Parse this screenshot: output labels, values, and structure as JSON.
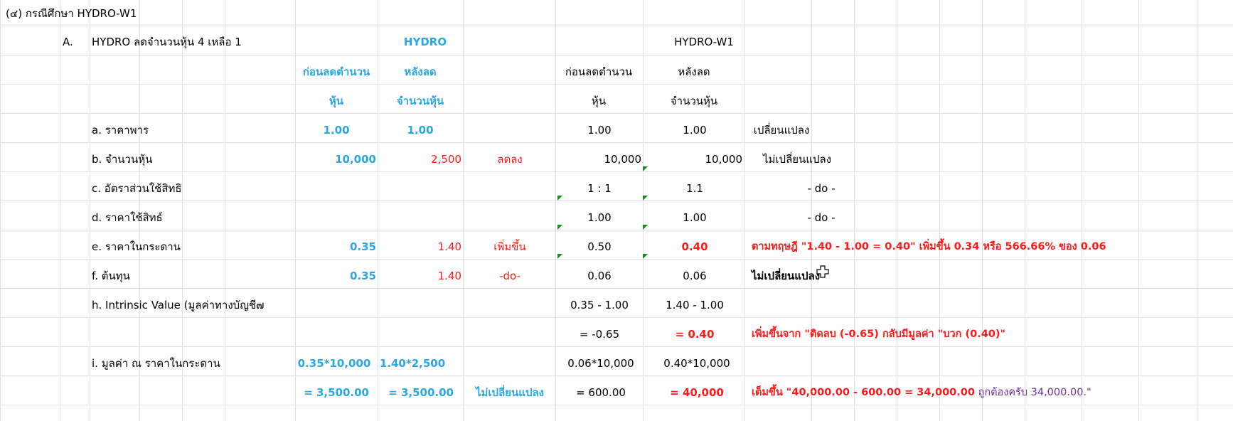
{
  "sheet": {
    "title": "(๔) กรณีศึกษา HYDRO-W1",
    "section_label": "A.",
    "section_title": "HYDRO ลดจำนวนหุ้น 4 เหลือ 1",
    "hydro_header": "HYDRO",
    "hydrow1_header": "HYDRO-W1",
    "col_before_1": "ก่อนลดตำนวน",
    "col_before_2": "หุ้น",
    "col_after_1": "หลังลด",
    "col_after_2": "จำนวนหุ้น",
    "w1_col_before_1": "ก่อนลดตำนวน",
    "w1_col_before_2": "หุ้น",
    "w1_col_after_1": "หลังลด",
    "w1_col_after_2": "จำนวนหุ้น",
    "rows": {
      "a": {
        "label": "a. ราคาพาร",
        "h_before": "1.00",
        "h_after": "1.00",
        "note": "",
        "w_before": "1.00",
        "w_after": "1.00",
        "comment": "เปลี่ยนแปลง"
      },
      "b": {
        "label": "b. จำนวนหุ้น",
        "h_before": "10,000",
        "h_after": "2,500",
        "note": "ลดลง",
        "w_before": "10,000",
        "w_after": "10,000",
        "comment": "ไม่เปลี่ยนแปลง"
      },
      "c": {
        "label": "c. อัตราส่วนใช้สิทธิ",
        "w_before": "1 : 1",
        "w_after": "1.1",
        "comment": "- do -"
      },
      "d": {
        "label": "d. ราคาใช้สิทธ์",
        "w_before": "1.00",
        "w_after": "1.00",
        "comment": "- do -"
      },
      "e": {
        "label": "e. ราคาในกระดาน",
        "h_before": "0.35",
        "h_after": "1.40",
        "note": "เพิ่มขึ้น",
        "w_before": "0.50",
        "w_after": "0.40",
        "comment": "ตามทฤษฎี \"1.40 - 1.00 = 0.40\" เพิ่มขึ้น 0.34 หรือ 566.66% ของ 0.06"
      },
      "f": {
        "label": "f.  ต้นทุน",
        "h_before": "0.35",
        "h_after": "1.40",
        "note": "-do-",
        "w_before": "0.06",
        "w_after": "0.06",
        "comment": "ไม่เปลี่ยนแปลง"
      },
      "h": {
        "label": "h.  Intrinsic Value (มูลค่าทางบัญชี๗",
        "w_before": "0.35 - 1.00",
        "w_after": "1.40 - 1.00"
      },
      "h2": {
        "w_before": "= -0.65",
        "w_after": "= 0.40",
        "comment": "เพิ่มขึ้นจาก \"ติดลบ (-0.65) กลับมีมูลค่า \"บวก (0.40)\""
      },
      "i": {
        "label": "i. มูลค่า ณ ราคาในกระดาน",
        "h_before": "0.35*10,000",
        "h_after": "1.40*2,500",
        "w_before": "0.06*10,000",
        "w_after": "0.40*10,000"
      },
      "i2": {
        "h_before": "= 3,500.00",
        "h_after": "= 3,500.00",
        "note": "ไม่เปลี่ยนแปลง",
        "w_before": "= 600.00",
        "w_after": "= 40,000",
        "comment_red": "เต็มขึ้น \"40,000.00 - 600.00 = 34,000.00",
        "comment_purple": "ถูกต้องครับ 34,000.00.\""
      }
    }
  },
  "colors": {
    "blue": "#2aa7e4",
    "red": "#ff1a1a",
    "purple": "#7030a0",
    "grid": "#e1e1e1",
    "note_marker": "#1a8a1a"
  },
  "icons": {
    "cursor": "cell-select-cross-icon"
  }
}
